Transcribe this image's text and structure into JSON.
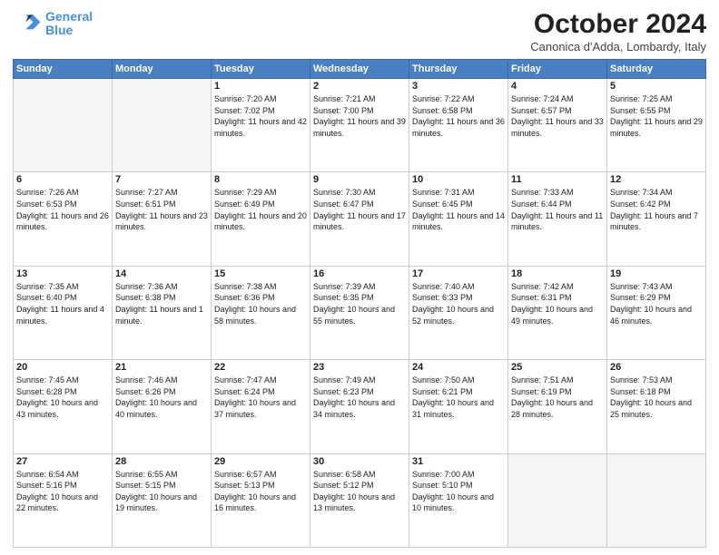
{
  "logo": {
    "line1": "General",
    "line2": "Blue"
  },
  "title": "October 2024",
  "location": "Canonica d'Adda, Lombardy, Italy",
  "days_of_week": [
    "Sunday",
    "Monday",
    "Tuesday",
    "Wednesday",
    "Thursday",
    "Friday",
    "Saturday"
  ],
  "weeks": [
    [
      {
        "day": "",
        "info": ""
      },
      {
        "day": "",
        "info": ""
      },
      {
        "day": "1",
        "info": "Sunrise: 7:20 AM\nSunset: 7:02 PM\nDaylight: 11 hours and 42 minutes."
      },
      {
        "day": "2",
        "info": "Sunrise: 7:21 AM\nSunset: 7:00 PM\nDaylight: 11 hours and 39 minutes."
      },
      {
        "day": "3",
        "info": "Sunrise: 7:22 AM\nSunset: 6:58 PM\nDaylight: 11 hours and 36 minutes."
      },
      {
        "day": "4",
        "info": "Sunrise: 7:24 AM\nSunset: 6:57 PM\nDaylight: 11 hours and 33 minutes."
      },
      {
        "day": "5",
        "info": "Sunrise: 7:25 AM\nSunset: 6:55 PM\nDaylight: 11 hours and 29 minutes."
      }
    ],
    [
      {
        "day": "6",
        "info": "Sunrise: 7:26 AM\nSunset: 6:53 PM\nDaylight: 11 hours and 26 minutes."
      },
      {
        "day": "7",
        "info": "Sunrise: 7:27 AM\nSunset: 6:51 PM\nDaylight: 11 hours and 23 minutes."
      },
      {
        "day": "8",
        "info": "Sunrise: 7:29 AM\nSunset: 6:49 PM\nDaylight: 11 hours and 20 minutes."
      },
      {
        "day": "9",
        "info": "Sunrise: 7:30 AM\nSunset: 6:47 PM\nDaylight: 11 hours and 17 minutes."
      },
      {
        "day": "10",
        "info": "Sunrise: 7:31 AM\nSunset: 6:45 PM\nDaylight: 11 hours and 14 minutes."
      },
      {
        "day": "11",
        "info": "Sunrise: 7:33 AM\nSunset: 6:44 PM\nDaylight: 11 hours and 11 minutes."
      },
      {
        "day": "12",
        "info": "Sunrise: 7:34 AM\nSunset: 6:42 PM\nDaylight: 11 hours and 7 minutes."
      }
    ],
    [
      {
        "day": "13",
        "info": "Sunrise: 7:35 AM\nSunset: 6:40 PM\nDaylight: 11 hours and 4 minutes."
      },
      {
        "day": "14",
        "info": "Sunrise: 7:36 AM\nSunset: 6:38 PM\nDaylight: 11 hours and 1 minute."
      },
      {
        "day": "15",
        "info": "Sunrise: 7:38 AM\nSunset: 6:36 PM\nDaylight: 10 hours and 58 minutes."
      },
      {
        "day": "16",
        "info": "Sunrise: 7:39 AM\nSunset: 6:35 PM\nDaylight: 10 hours and 55 minutes."
      },
      {
        "day": "17",
        "info": "Sunrise: 7:40 AM\nSunset: 6:33 PM\nDaylight: 10 hours and 52 minutes."
      },
      {
        "day": "18",
        "info": "Sunrise: 7:42 AM\nSunset: 6:31 PM\nDaylight: 10 hours and 49 minutes."
      },
      {
        "day": "19",
        "info": "Sunrise: 7:43 AM\nSunset: 6:29 PM\nDaylight: 10 hours and 46 minutes."
      }
    ],
    [
      {
        "day": "20",
        "info": "Sunrise: 7:45 AM\nSunset: 6:28 PM\nDaylight: 10 hours and 43 minutes."
      },
      {
        "day": "21",
        "info": "Sunrise: 7:46 AM\nSunset: 6:26 PM\nDaylight: 10 hours and 40 minutes."
      },
      {
        "day": "22",
        "info": "Sunrise: 7:47 AM\nSunset: 6:24 PM\nDaylight: 10 hours and 37 minutes."
      },
      {
        "day": "23",
        "info": "Sunrise: 7:49 AM\nSunset: 6:23 PM\nDaylight: 10 hours and 34 minutes."
      },
      {
        "day": "24",
        "info": "Sunrise: 7:50 AM\nSunset: 6:21 PM\nDaylight: 10 hours and 31 minutes."
      },
      {
        "day": "25",
        "info": "Sunrise: 7:51 AM\nSunset: 6:19 PM\nDaylight: 10 hours and 28 minutes."
      },
      {
        "day": "26",
        "info": "Sunrise: 7:53 AM\nSunset: 6:18 PM\nDaylight: 10 hours and 25 minutes."
      }
    ],
    [
      {
        "day": "27",
        "info": "Sunrise: 6:54 AM\nSunset: 5:16 PM\nDaylight: 10 hours and 22 minutes."
      },
      {
        "day": "28",
        "info": "Sunrise: 6:55 AM\nSunset: 5:15 PM\nDaylight: 10 hours and 19 minutes."
      },
      {
        "day": "29",
        "info": "Sunrise: 6:57 AM\nSunset: 5:13 PM\nDaylight: 10 hours and 16 minutes."
      },
      {
        "day": "30",
        "info": "Sunrise: 6:58 AM\nSunset: 5:12 PM\nDaylight: 10 hours and 13 minutes."
      },
      {
        "day": "31",
        "info": "Sunrise: 7:00 AM\nSunset: 5:10 PM\nDaylight: 10 hours and 10 minutes."
      },
      {
        "day": "",
        "info": ""
      },
      {
        "day": "",
        "info": ""
      }
    ]
  ]
}
